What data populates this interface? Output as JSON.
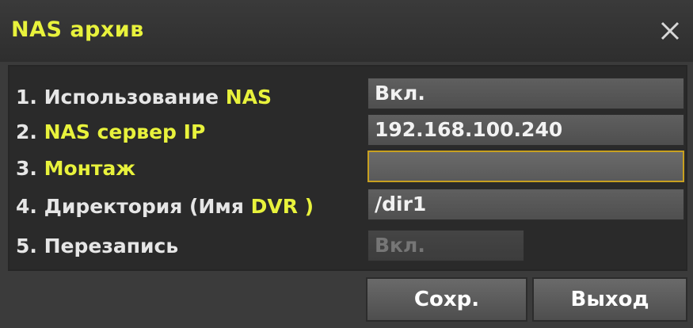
{
  "window": {
    "title": "NAS архив"
  },
  "rows": [
    {
      "num": "1.",
      "label_a": "Использование ",
      "label_hl": "NAS",
      "value": "Вкл."
    },
    {
      "num": "2.",
      "label_a": "",
      "label_hl": "NAS сервер IP",
      "value": "192.168.100.240"
    },
    {
      "num": "3.",
      "label_a": "",
      "label_hl": "Монтаж",
      "value": ""
    },
    {
      "num": "4.",
      "label_a": "Директория (Имя ",
      "label_hl": "DVR )",
      "value": "/dir1"
    },
    {
      "num": "5.",
      "label_a": "Перезапись",
      "label_hl": "",
      "value": "Вкл."
    }
  ],
  "buttons": {
    "save": "Сохр.",
    "exit": "Выход"
  },
  "colors": {
    "title": "#e8f23c",
    "focus_border": "#c8a020"
  },
  "icons": {
    "close": "close-icon"
  }
}
